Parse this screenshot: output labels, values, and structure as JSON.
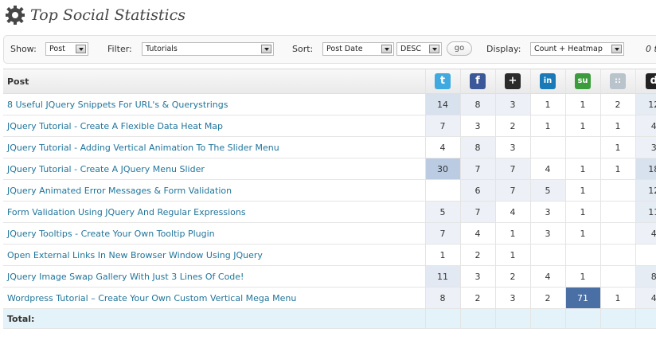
{
  "page": {
    "title": "Top Social Statistics"
  },
  "filters": {
    "show_label": "Show:",
    "show_value": "Post",
    "filter_label": "Filter:",
    "filter_value": "Tutorials",
    "sort_label": "Sort:",
    "sort_value": "Post Date",
    "order_value": "DESC",
    "go_label": "go",
    "display_label": "Display:",
    "display_value": "Count + Heatmap",
    "cutoff_text": "0 t"
  },
  "table": {
    "post_header": "Post",
    "columns": [
      {
        "icon": "twitter-icon",
        "glyph": "t",
        "color": "#3fa9e0"
      },
      {
        "icon": "facebook-icon",
        "glyph": "f",
        "color": "#3b5998"
      },
      {
        "icon": "google-buzz-icon",
        "glyph": "+",
        "color": "#2b2b2b"
      },
      {
        "icon": "linkedin-icon",
        "glyph": "in",
        "color": "#1a7ab8"
      },
      {
        "icon": "stumbleupon-icon",
        "glyph": "su",
        "color": "#3c9b3c"
      },
      {
        "icon": "delicious-icon",
        "glyph": "::",
        "color": "#b8c3cc"
      },
      {
        "icon": "digg-icon",
        "glyph": "d",
        "color": "#222222"
      }
    ],
    "rows": [
      {
        "post": "8 Useful JQuery Snippets For URL's & Querystrings",
        "values": [
          "14",
          "8",
          "3",
          "1",
          "1",
          "2",
          "12"
        ],
        "heat": [
          0.25,
          0.05,
          0.02,
          0,
          0,
          0,
          0.12
        ]
      },
      {
        "post": "JQuery Tutorial - Create A Flexible Data Heat Map",
        "values": [
          "7",
          "3",
          "2",
          "1",
          "1",
          "1",
          "4"
        ],
        "heat": [
          0.05,
          0,
          0,
          0,
          0,
          0,
          0.05
        ]
      },
      {
        "post": "JQuery Tutorial - Adding Vertical Animation To The Slider Menu",
        "values": [
          "4",
          "8",
          "3",
          "",
          "",
          "1",
          "3"
        ],
        "heat": [
          0,
          0.05,
          0,
          0,
          0,
          0,
          0.05
        ]
      },
      {
        "post": "JQuery Tutorial - Create A JQuery Menu Slider",
        "values": [
          "30",
          "7",
          "7",
          "4",
          "1",
          "1",
          "18"
        ],
        "heat": [
          0.55,
          0.05,
          0.05,
          0,
          0,
          0,
          0.25
        ]
      },
      {
        "post": "JQuery Animated Error Messages & Form Validation",
        "values": [
          "",
          "6",
          "7",
          "5",
          "1",
          "",
          "12"
        ],
        "heat": [
          0,
          0.05,
          0.05,
          0.05,
          0,
          0,
          0.12
        ]
      },
      {
        "post": "Form Validation Using JQuery And Regular Expressions",
        "values": [
          "5",
          "7",
          "4",
          "3",
          "1",
          "",
          "11"
        ],
        "heat": [
          0.05,
          0.05,
          0,
          0,
          0,
          0,
          0.12
        ]
      },
      {
        "post": "JQuery Tooltips - Create Your Own Tooltip Plugin",
        "values": [
          "7",
          "4",
          "1",
          "3",
          "1",
          "",
          "4"
        ],
        "heat": [
          0.05,
          0,
          0,
          0,
          0,
          0,
          0.05
        ]
      },
      {
        "post": "Open External Links In New Browser Window Using JQuery",
        "values": [
          "1",
          "2",
          "1",
          "",
          "",
          "",
          ""
        ],
        "heat": [
          0,
          0,
          0,
          0,
          0,
          0,
          0
        ]
      },
      {
        "post": "JQuery Image Swap Gallery With Just 3 Lines Of Code!",
        "values": [
          "11",
          "3",
          "2",
          "4",
          "1",
          "",
          "8"
        ],
        "heat": [
          0.15,
          0,
          0,
          0,
          0,
          0,
          0.1
        ]
      },
      {
        "post": "Wordpress Tutorial – Create Your Own Custom Vertical Mega Menu",
        "values": [
          "8",
          "2",
          "3",
          "2",
          "71",
          "1",
          "4"
        ],
        "heat": [
          0.05,
          0,
          0,
          0,
          1.0,
          0,
          0.05
        ]
      }
    ],
    "total_label": "Total:"
  }
}
